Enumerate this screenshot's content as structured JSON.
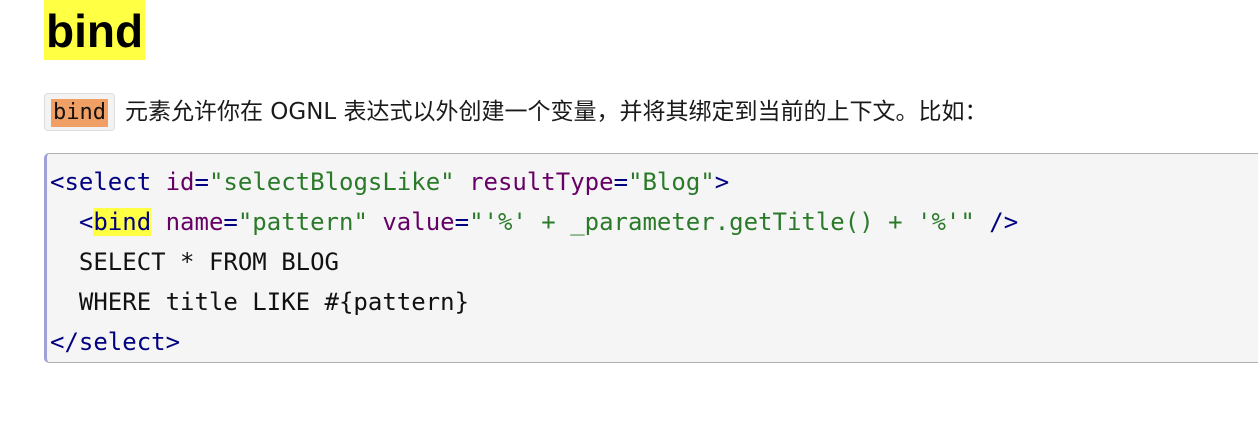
{
  "heading": "bind",
  "paragraph": {
    "code": "bind",
    "text": "元素允许你在 OGNL 表达式以外创建一个变量，并将其绑定到当前的上下文。比如："
  },
  "code_block": {
    "lines": [
      [
        {
          "t": "<select",
          "c": "tag"
        },
        {
          "t": " ",
          "c": "plain"
        },
        {
          "t": "id",
          "c": "attr"
        },
        {
          "t": "=",
          "c": "tag"
        },
        {
          "t": "\"selectBlogsLike\"",
          "c": "str"
        },
        {
          "t": " ",
          "c": "plain"
        },
        {
          "t": "resultType",
          "c": "attr"
        },
        {
          "t": "=",
          "c": "tag"
        },
        {
          "t": "\"Blog\"",
          "c": "str"
        },
        {
          "t": ">",
          "c": "tag"
        }
      ],
      [
        {
          "t": "  <",
          "c": "tag"
        },
        {
          "t": "bind",
          "c": "hl"
        },
        {
          "t": " ",
          "c": "plain"
        },
        {
          "t": "name",
          "c": "attr"
        },
        {
          "t": "=",
          "c": "tag"
        },
        {
          "t": "\"pattern\"",
          "c": "str"
        },
        {
          "t": " ",
          "c": "plain"
        },
        {
          "t": "value",
          "c": "attr"
        },
        {
          "t": "=",
          "c": "tag"
        },
        {
          "t": "\"'%' + _parameter.getTitle() + '%'\"",
          "c": "str"
        },
        {
          "t": " />",
          "c": "tag"
        }
      ],
      [
        {
          "t": "  SELECT * FROM BLOG",
          "c": "plain"
        }
      ],
      [
        {
          "t": "  WHERE title LIKE #{pattern}",
          "c": "plain"
        }
      ],
      [
        {
          "t": "</select>",
          "c": "tag"
        }
      ]
    ]
  }
}
